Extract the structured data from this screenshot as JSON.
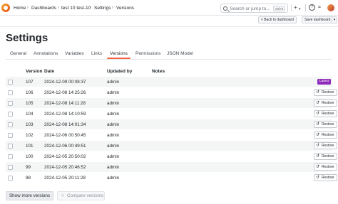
{
  "breadcrumb": [
    "Home",
    "Dashboards",
    "test 10 test-10",
    "Settings",
    "Versions"
  ],
  "search": {
    "placeholder": "Search or jump to...",
    "shortcut": "ctrl+k"
  },
  "toolbar": {
    "plus": "+",
    "help": "?"
  },
  "subbar": {
    "back_label": "< Back to dashboard",
    "save_label": "Save dashboard",
    "more": "⌄"
  },
  "page": {
    "title": "Settings"
  },
  "tabs": [
    {
      "label": "General"
    },
    {
      "label": "Annotations"
    },
    {
      "label": "Variables"
    },
    {
      "label": "Links"
    },
    {
      "label": "Versions",
      "active": true
    },
    {
      "label": "Permissions"
    },
    {
      "label": "JSON Model"
    }
  ],
  "table": {
    "headers": {
      "version": "Version",
      "date": "Date",
      "updated_by": "Updated by",
      "notes": "Notes"
    },
    "latest_label": "Latest",
    "restore_label": "Restore",
    "rows": [
      {
        "version": "107",
        "date": "2024-12-09 00:08:37",
        "updated_by": "admin",
        "notes": "",
        "latest": true
      },
      {
        "version": "106",
        "date": "2024-12-08 14:25:26",
        "updated_by": "admin",
        "notes": ""
      },
      {
        "version": "105",
        "date": "2024-12-08 14:11:28",
        "updated_by": "admin",
        "notes": ""
      },
      {
        "version": "104",
        "date": "2024-12-08 14:10:59",
        "updated_by": "admin",
        "notes": ""
      },
      {
        "version": "103",
        "date": "2024-12-08 14:01:34",
        "updated_by": "admin",
        "notes": ""
      },
      {
        "version": "102",
        "date": "2024-12-06 00:50:45",
        "updated_by": "admin",
        "notes": ""
      },
      {
        "version": "101",
        "date": "2024-12-06 00:49:51",
        "updated_by": "admin",
        "notes": ""
      },
      {
        "version": "100",
        "date": "2024-12-05 20:50:02",
        "updated_by": "admin",
        "notes": ""
      },
      {
        "version": "99",
        "date": "2024-12-05 20:46:52",
        "updated_by": "admin",
        "notes": ""
      },
      {
        "version": "98",
        "date": "2024-12-05 20:11:28",
        "updated_by": "admin",
        "notes": ""
      }
    ]
  },
  "actions": {
    "show_more": "Show more versions",
    "compare": "Compare versions"
  },
  "colors": {
    "accent": "#f55f3e",
    "latest_badge": "#8f2dbb"
  }
}
